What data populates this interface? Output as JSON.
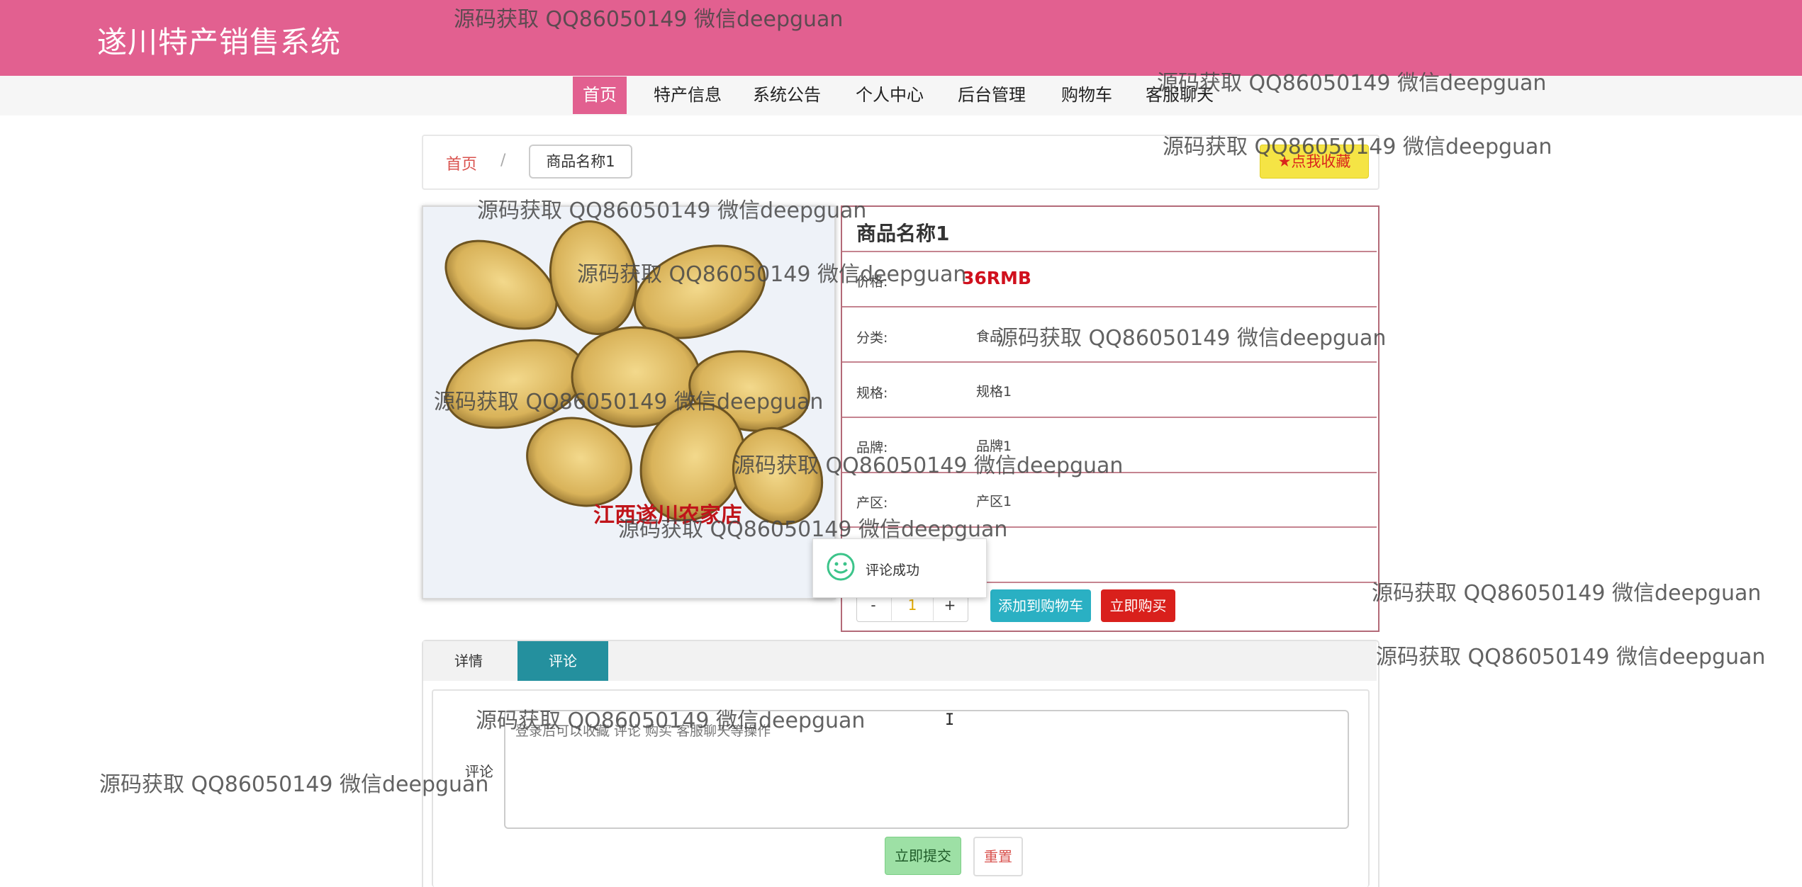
{
  "header": {
    "site_title": "遂川特产销售系统"
  },
  "nav": {
    "items": [
      "首页",
      "特产信息",
      "系统公告",
      "个人中心",
      "后台管理",
      "购物车",
      "客服聊天"
    ],
    "active": "首页"
  },
  "breadcrumb": {
    "home": "首页",
    "separator": "/",
    "current": "商品名称1"
  },
  "favorite_button": {
    "icon": "star-icon",
    "label": "点我收藏"
  },
  "product": {
    "image_caption": "江西遂川农家店",
    "name": "商品名称1",
    "price_label": "价格:",
    "price": "36RMB",
    "category_label": "分类:",
    "category": "食品",
    "spec_label": "规格:",
    "spec": "规格1",
    "brand_label": "品牌:",
    "brand": "品牌1",
    "origin_label": "产区:",
    "origin": "产区1"
  },
  "quantity": {
    "minus": "-",
    "value": "1",
    "plus": "+"
  },
  "actions": {
    "add_to_cart": "添加到购物车",
    "buy_now": "立即购买"
  },
  "toast": {
    "icon": "smile-icon",
    "message": "评论成功"
  },
  "tabs": {
    "items": [
      "详情",
      "评论"
    ],
    "active": "评论"
  },
  "comment_form": {
    "label": "评论",
    "placeholder": "登录后可以收藏 评论 购买 客服聊天等操作",
    "submit": "立即提交",
    "reset": "重置"
  },
  "watermark": {
    "text": "源码获取 QQ86050149 微信deepguan"
  },
  "colors": {
    "brand": "#e26090",
    "price": "#d0101d",
    "tab_active": "#24909e",
    "cart_button": "#2ab0c3",
    "buy_button": "#d9201c"
  }
}
